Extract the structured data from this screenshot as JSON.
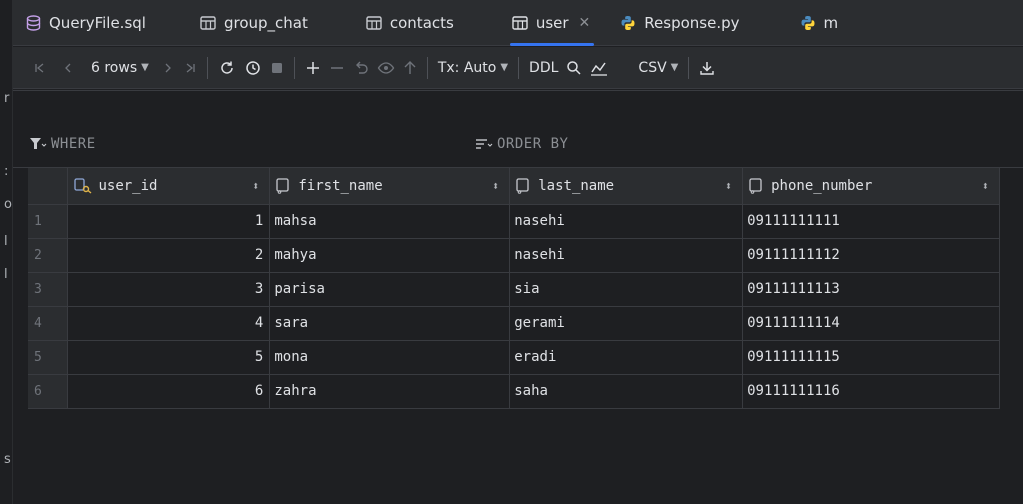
{
  "tabs": [
    {
      "label": "QueryFile.sql",
      "icon": "database-icon"
    },
    {
      "label": "group_chat",
      "icon": "table-icon"
    },
    {
      "label": "contacts",
      "icon": "table-icon"
    },
    {
      "label": "user",
      "icon": "table-icon",
      "active": true
    },
    {
      "label": "Response.py",
      "icon": "python-icon"
    },
    {
      "label": "m",
      "icon": "python-icon"
    }
  ],
  "toolbar": {
    "rows_label": "6 rows",
    "tx_label": "Tx: Auto",
    "ddl_label": "DDL",
    "csv_label": "CSV"
  },
  "filter": {
    "where_label": "WHERE",
    "orderby_label": "ORDER BY"
  },
  "table": {
    "columns": [
      "user_id",
      "first_name",
      "last_name",
      "phone_number"
    ],
    "rows": [
      {
        "n": "1",
        "user_id": "1",
        "first_name": "mahsa",
        "last_name": "nasehi",
        "phone_number": "09111111111"
      },
      {
        "n": "2",
        "user_id": "2",
        "first_name": "mahya",
        "last_name": "nasehi",
        "phone_number": "09111111112"
      },
      {
        "n": "3",
        "user_id": "3",
        "first_name": "parisa",
        "last_name": "sia",
        "phone_number": "09111111113"
      },
      {
        "n": "4",
        "user_id": "4",
        "first_name": "sara",
        "last_name": "gerami",
        "phone_number": "09111111114"
      },
      {
        "n": "5",
        "user_id": "5",
        "first_name": "mona",
        "last_name": "eradi",
        "phone_number": "09111111115"
      },
      {
        "n": "6",
        "user_id": "6",
        "first_name": "zahra",
        "last_name": "saha",
        "phone_number": "09111111116"
      }
    ]
  },
  "colors": {
    "accent": "#3574f0",
    "python_blue": "#4b8bbe",
    "python_yellow": "#ffd43b"
  }
}
